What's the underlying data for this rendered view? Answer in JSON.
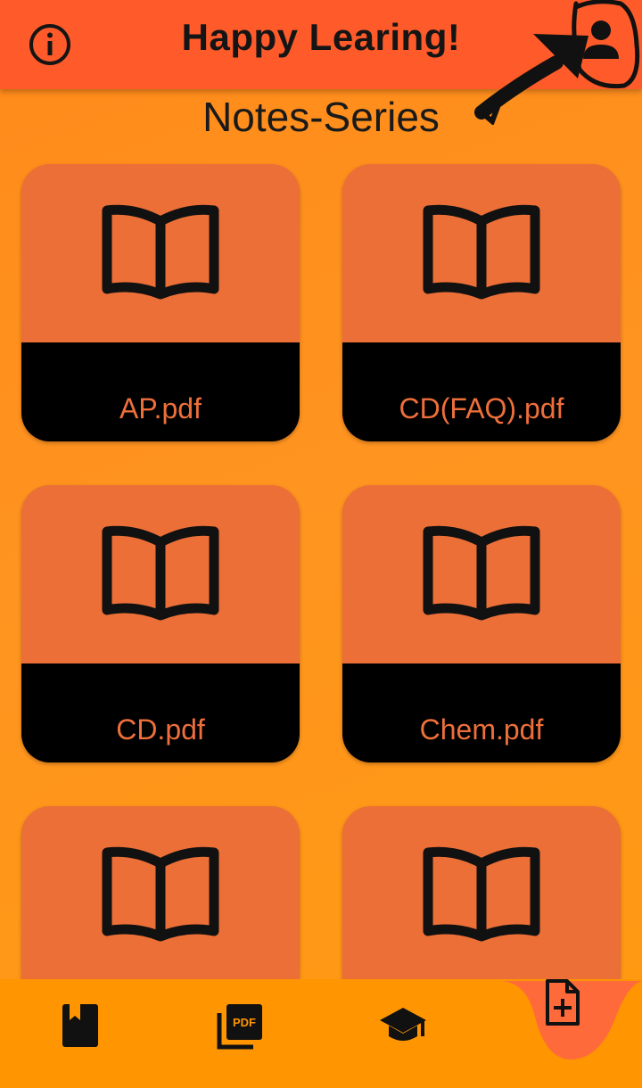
{
  "appbar": {
    "title": "Happy Learing!"
  },
  "section": {
    "title": "Notes-Series"
  },
  "cards": [
    {
      "label": "AP.pdf"
    },
    {
      "label": "CD(FAQ).pdf"
    },
    {
      "label": "CD.pdf"
    },
    {
      "label": "Chem.pdf"
    },
    {
      "label": ""
    },
    {
      "label": ""
    }
  ],
  "colors": {
    "appbar": "#ff5a2a",
    "background": "#ff9420",
    "card": "#ec6f37",
    "card_footer": "#000000",
    "card_label": "#ee6f3a",
    "bottom_nav": "#ff9500",
    "fab": "#ff6a3a"
  },
  "icons": {
    "info": "info-circle-icon",
    "profile": "person-icon",
    "card": "open-book-icon",
    "nav": [
      "bookmark-book-icon",
      "pdf-icon",
      "graduation-cap-icon",
      "add-note-icon"
    ]
  }
}
